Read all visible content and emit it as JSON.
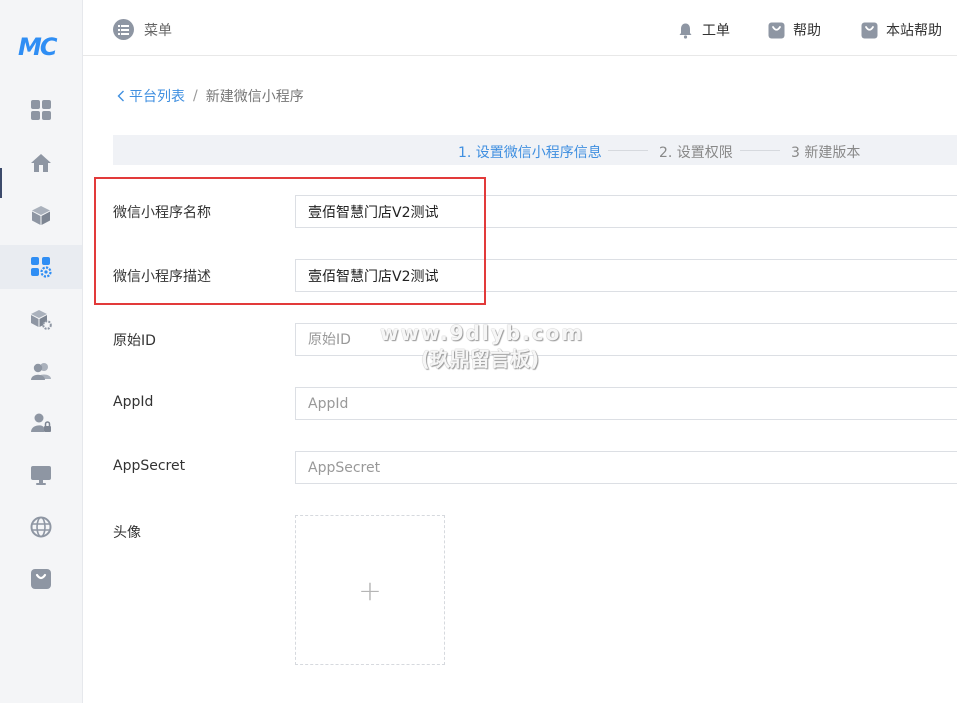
{
  "brand": {
    "logo_text": "MC"
  },
  "sidebar": {
    "items": [
      {
        "icon": "dashboard-icon"
      },
      {
        "icon": "home-icon"
      },
      {
        "icon": "cube-icon"
      },
      {
        "icon": "apps-settings-icon",
        "active": true
      },
      {
        "icon": "package-settings-icon"
      },
      {
        "icon": "users-icon"
      },
      {
        "icon": "user-lock-icon"
      },
      {
        "icon": "monitor-icon"
      },
      {
        "icon": "globe-icon"
      },
      {
        "icon": "shop-bag-icon"
      }
    ]
  },
  "header": {
    "menu_label": "菜单",
    "ticket_label": "工单",
    "help_label": "帮助",
    "site_help_label": "本站帮助"
  },
  "breadcrumb": {
    "back_label": "平台列表",
    "separator": "/",
    "current": "新建微信小程序"
  },
  "steps": [
    {
      "label": "1. 设置微信小程序信息",
      "active": true
    },
    {
      "label": "2. 设置权限",
      "active": false
    },
    {
      "label": "3 新建版本",
      "active": false
    }
  ],
  "form": {
    "name": {
      "label": "微信小程序名称",
      "value": "壹佰智慧门店V2测试"
    },
    "description": {
      "label": "微信小程序描述",
      "value": "壹佰智慧门店V2测试"
    },
    "original_id": {
      "label": "原始ID",
      "placeholder": "原始ID"
    },
    "app_id": {
      "label": "AppId",
      "placeholder": "AppId"
    },
    "app_secret": {
      "label": "AppSecret",
      "placeholder": "AppSecret"
    },
    "avatar": {
      "label": "头像",
      "upload_symbol": "+"
    }
  },
  "watermark": {
    "line1": "www.9dlyb.com",
    "line2": "(玖鼎留言板)"
  },
  "colors": {
    "accent": "#3f8fe0",
    "highlight": "#e23a3a",
    "icon": "#8e96a3"
  }
}
